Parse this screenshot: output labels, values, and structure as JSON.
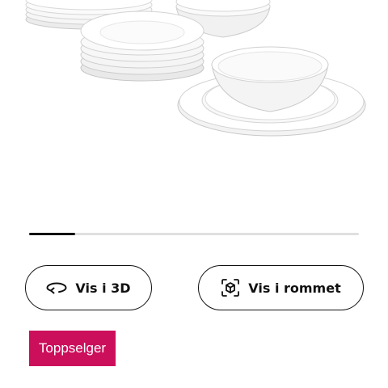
{
  "product": {
    "image_alt": "dinnerware-set-photo"
  },
  "gallery": {
    "progress": 0.14
  },
  "buttons": {
    "view_3d": {
      "label": "Vis i 3D",
      "icon": "rotate-3d-icon"
    },
    "view_in_room": {
      "label": "Vis i rommet",
      "icon": "ar-cube-icon"
    }
  },
  "badge": {
    "label": "Toppselger",
    "color": "#cc0f5b"
  }
}
